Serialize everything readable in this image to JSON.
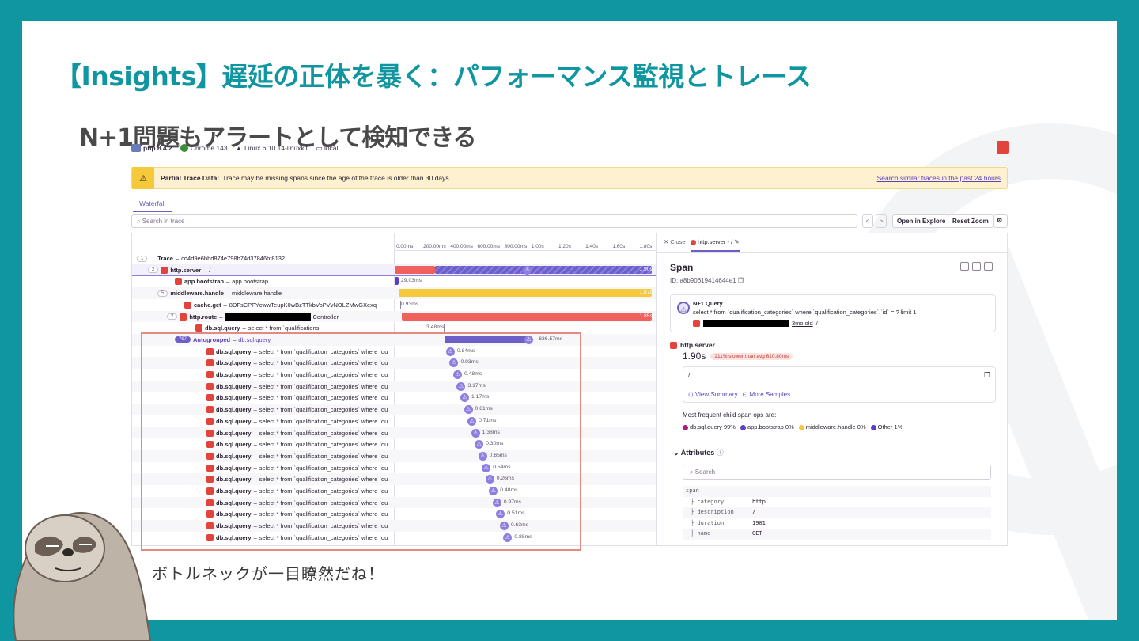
{
  "slide": {
    "title": "【Insights】遅延の正体を暴く：パフォーマンス監視とトレース",
    "subtitle": "N+1問題もアラートとして検知できる",
    "caption": "ボトルネックが一目瞭然だね！",
    "accent_color": "#0f96a0"
  },
  "env": {
    "php": "php 8.4.2",
    "chrome": "Chrome 143",
    "linux": "Linux 6.10.14-linuxkit",
    "local": "local"
  },
  "warning": {
    "title": "Partial Trace Data:",
    "text": "Trace may be missing spans since the age of the trace is older than 30 days",
    "link": "Search similar traces in the past 24 hours"
  },
  "toolbar": {
    "tab": "Waterfall",
    "search_placeholder": "Search in trace",
    "prev": "<",
    "next": ">",
    "open_explore": "Open in Explore",
    "reset_zoom": "Reset Zoom",
    "settings": "⚙"
  },
  "axis": [
    "0.00ms",
    "200.00ms",
    "400.00ms",
    "600.00ms",
    "800.00ms",
    "1.00s",
    "1.20s",
    "1.40s",
    "1.60s",
    "1.80s"
  ],
  "trace": {
    "trace_row": {
      "count": "1",
      "label": "Trace",
      "desc": "cd4d9e6bbd874e798b74d37846bf8132"
    },
    "server_row": {
      "count": "2",
      "label": "http.server",
      "desc": "/",
      "duration": "1.90s"
    },
    "bootstrap_row": {
      "label": "app.bootstrap",
      "desc": "app.bootstrap",
      "duration": "29.03ms"
    },
    "middleware_row": {
      "count": "5",
      "label": "middleware.handle",
      "desc": "middleware.handle",
      "duration": "1.87s"
    },
    "cache_row": {
      "label": "cache.get",
      "desc": "8DFsCPFYcwwTeupK0wBzTTkbVoPVvNOLZMwGXexq",
      "duration": "0.93ms"
    },
    "route_row": {
      "count": "2",
      "label": "http.route",
      "desc": "Controller",
      "duration": "1.85s"
    },
    "quals_row": {
      "label": "db.sql.query",
      "desc": "select * from `qualifications`",
      "duration": "3.48ms"
    },
    "autogroup_row": {
      "count": "797",
      "label": "Autogrouped",
      "desc": "db.sql.query",
      "duration": "636.57ms"
    },
    "query_label": "db.sql.query",
    "query_desc": "select * from `qualification_categories` where `qu",
    "queries": [
      {
        "duration": "0.84ms"
      },
      {
        "duration": "0.93ms"
      },
      {
        "duration": "0.48ms"
      },
      {
        "duration": "3.17ms"
      },
      {
        "duration": "1.17ms"
      },
      {
        "duration": "0.81ms"
      },
      {
        "duration": "0.71ms"
      },
      {
        "duration": "1.38ms"
      },
      {
        "duration": "0.30ms"
      },
      {
        "duration": "0.65ms"
      },
      {
        "duration": "0.54ms"
      },
      {
        "duration": "0.26ms"
      },
      {
        "duration": "0.48ms"
      },
      {
        "duration": "0.97ms"
      },
      {
        "duration": "0.51ms"
      },
      {
        "duration": "0.63ms"
      },
      {
        "duration": "0.88ms"
      }
    ]
  },
  "detail": {
    "close": "Close",
    "tab": "http.server - /",
    "title": "Span",
    "id": "ID: a8b90619414644e1",
    "nplus_title": "N+1 Query",
    "nplus_query": "select * from `qualification_categories` where `qualification_categories`.`id` = ? limit 1",
    "nplus_age": "3mo old",
    "nplus_slash": "/",
    "server_label": "http.server",
    "duration": "1.90s",
    "slower": "211% slower than avg 610.80ms",
    "path": "/",
    "view_summary": "View Summary",
    "more_samples": "More Samples",
    "most_frequent": "Most frequent child span ops are:",
    "ops": [
      {
        "label": "db.sql.query 99%",
        "color": "#a3237a"
      },
      {
        "label": "app.bootstrap 0%",
        "color": "#5b3fc5"
      },
      {
        "label": "middleware.handle 0%",
        "color": "#f5c93a"
      },
      {
        "label": "Other 1%",
        "color": "#5b3fc5"
      }
    ],
    "attributes": "Attributes",
    "attr_search": "Search",
    "attr_root": "span",
    "attrs": [
      {
        "k": "category",
        "v": "http"
      },
      {
        "k": "description",
        "v": "/"
      },
      {
        "k": "duration",
        "v": "1901"
      },
      {
        "k": "name",
        "v": "GET"
      }
    ]
  }
}
